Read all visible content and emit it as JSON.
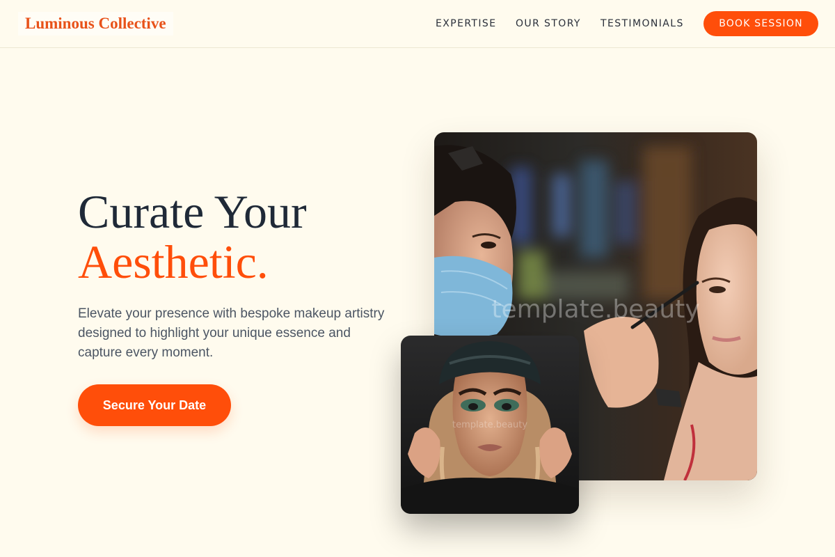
{
  "brand": {
    "name": "Luminous Collective"
  },
  "nav": {
    "links": [
      {
        "label": "EXPERTISE"
      },
      {
        "label": "OUR STORY"
      },
      {
        "label": "TESTIMONIALS"
      }
    ],
    "book_label": "BOOK SESSION"
  },
  "hero": {
    "title_line1": "Curate Your",
    "title_line2": "Aesthetic.",
    "subtitle": "Elevate your presence with bespoke makeup artistry designed to highlight your unique essence and capture every moment.",
    "cta_label": "Secure Your Date"
  },
  "images": {
    "main_watermark": "template.beauty",
    "small_watermark": "template.beauty"
  },
  "colors": {
    "background": "#fffbee",
    "accent": "#ff4e0a",
    "heading": "#1f2937",
    "body_text": "#4b5563"
  }
}
